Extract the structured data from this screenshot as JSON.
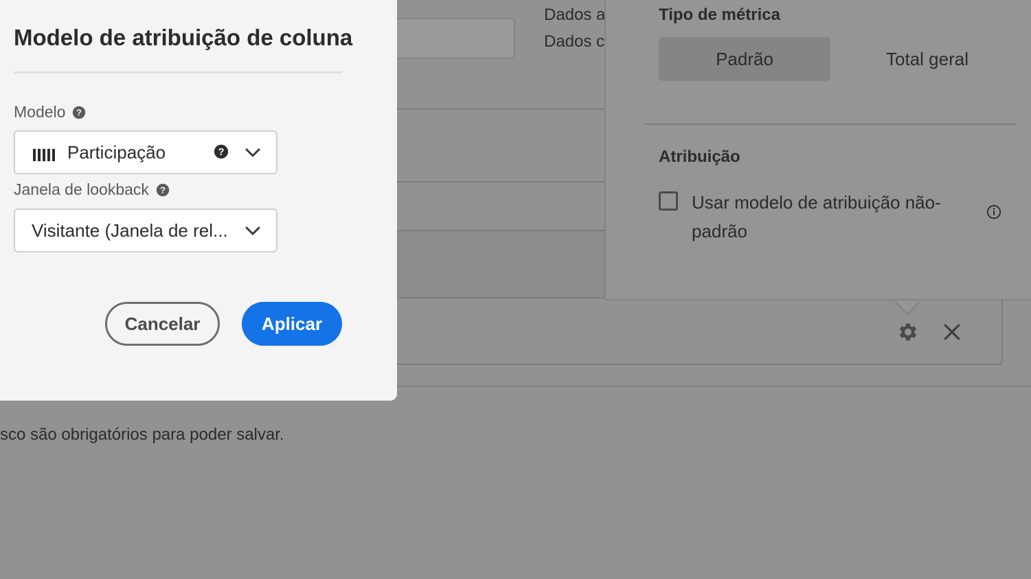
{
  "background": {
    "side_text_1": "Dados at",
    "side_text_2": "Dados c",
    "footnote": "sco são obrigatórios para poder salvar."
  },
  "row_actions": {
    "gear_icon": "gear-icon",
    "close_icon": "close-icon"
  },
  "popover": {
    "metric_type_heading": "Tipo de métrica",
    "segments": [
      "Padrão",
      "Total geral"
    ],
    "selected_segment": "Padrão",
    "attribution_heading": "Atribuição",
    "checkbox_label": "Usar modelo de atribuição não-padrão",
    "checkbox_checked": false,
    "info_icon": "info-icon"
  },
  "modal": {
    "title": "Modelo de atribuição de coluna",
    "model_label": "Modelo",
    "model_value": "Participação",
    "model_icon": "participation-bars-icon",
    "lookback_label": "Janela de lookback",
    "lookback_value": "Visitante (Janela de rel...",
    "cancel_label": "Cancelar",
    "apply_label": "Aplicar"
  },
  "colors": {
    "accent": "#1473e6",
    "overlay": "#929292",
    "modal_bg": "#f4f4f4"
  }
}
